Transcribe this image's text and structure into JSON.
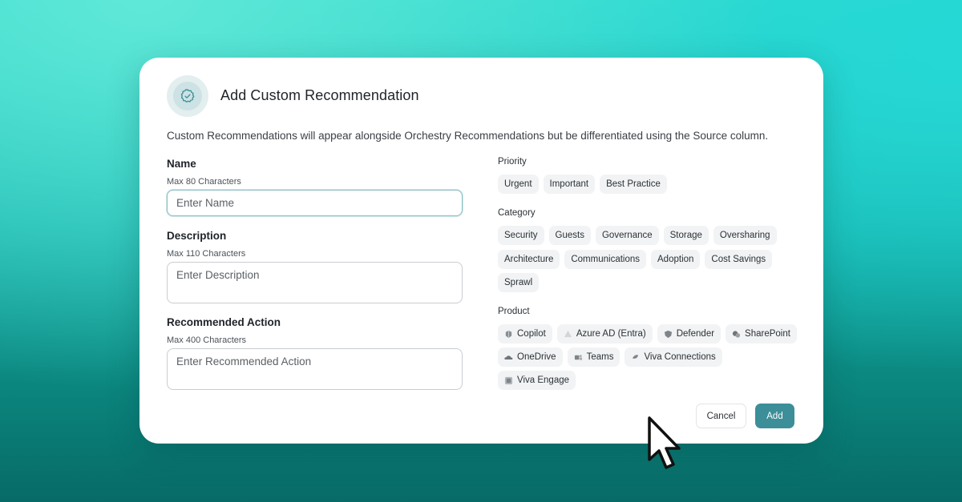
{
  "dialog": {
    "title": "Add Custom Recommendation",
    "icon": "badge-check-icon",
    "subtitle": "Custom Recommendations will appear alongside Orchestry Recommendations but be differentiated using the Source column."
  },
  "form": {
    "name": {
      "label": "Name",
      "hint": "Max 80 Characters",
      "placeholder": "Enter Name",
      "value": ""
    },
    "description": {
      "label": "Description",
      "hint": "Max 110 Characters",
      "placeholder": "Enter Description",
      "value": ""
    },
    "action": {
      "label": "Recommended Action",
      "hint": "Max 400 Characters",
      "placeholder": "Enter Recommended Action",
      "value": ""
    }
  },
  "priority": {
    "label": "Priority",
    "options": [
      "Urgent",
      "Important",
      "Best Practice"
    ]
  },
  "category": {
    "label": "Category",
    "options": [
      "Security",
      "Guests",
      "Governance",
      "Storage",
      "Oversharing",
      "Architecture",
      "Communications",
      "Adoption",
      "Cost Savings",
      "Sprawl"
    ]
  },
  "product": {
    "label": "Product",
    "options": [
      {
        "label": "Copilot",
        "icon": "copilot-icon"
      },
      {
        "label": "Azure AD (Entra)",
        "icon": "azure-ad-icon"
      },
      {
        "label": "Defender",
        "icon": "defender-icon"
      },
      {
        "label": "SharePoint",
        "icon": "sharepoint-icon"
      },
      {
        "label": "OneDrive",
        "icon": "onedrive-icon"
      },
      {
        "label": "Teams",
        "icon": "teams-icon"
      },
      {
        "label": "Viva Connections",
        "icon": "viva-connections-icon"
      },
      {
        "label": "Viva Engage",
        "icon": "viva-engage-icon"
      }
    ]
  },
  "actions": {
    "cancel": "Cancel",
    "add": "Add"
  },
  "colors": {
    "accent": "#3c8e98",
    "background_top": "#2fd9cb",
    "background_bottom": "#086a66"
  }
}
